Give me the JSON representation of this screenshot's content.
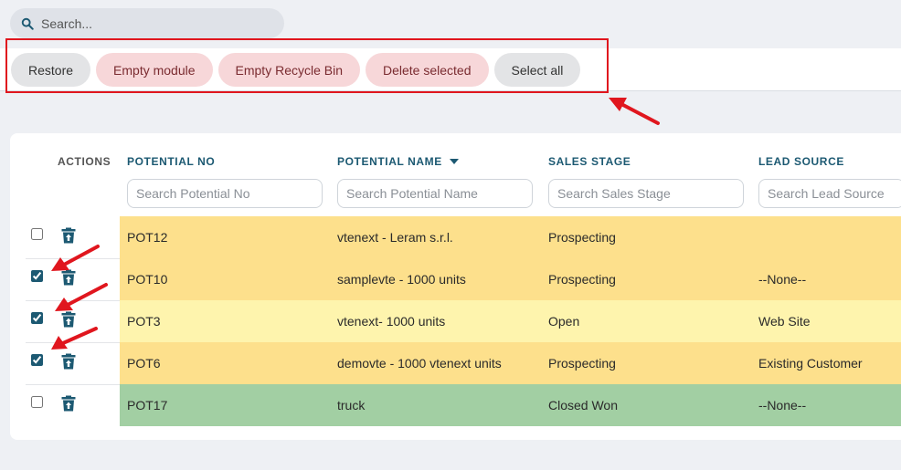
{
  "search": {
    "placeholder": "Search..."
  },
  "toolbar": {
    "restore": "Restore",
    "empty_module": "Empty module",
    "empty_recycle_bin": "Empty Recycle Bin",
    "delete_selected": "Delete selected",
    "select_all": "Select all"
  },
  "table": {
    "headers": {
      "actions": "ACTIONS",
      "potential_no": "POTENTIAL NO",
      "potential_name": "POTENTIAL NAME",
      "sales_stage": "SALES STAGE",
      "lead_source": "LEAD SOURCE"
    },
    "filters": {
      "potential_no": "Search Potential No",
      "potential_name": "Search Potential Name",
      "sales_stage": "Search Sales Stage",
      "lead_source": "Search Lead Source"
    },
    "rows": [
      {
        "no": "POT12",
        "name": "vtenext - Leram s.r.l.",
        "stage": "Prospecting",
        "source": "",
        "checked": false,
        "color": "#fde08c"
      },
      {
        "no": "POT10",
        "name": "samplevte - 1000 units",
        "stage": "Prospecting",
        "source": "--None--",
        "checked": true,
        "color": "#fde08c"
      },
      {
        "no": "POT3",
        "name": "vtenext- 1000 units",
        "stage": "Open",
        "source": "Web Site",
        "checked": true,
        "color": "#fef4ad"
      },
      {
        "no": "POT6",
        "name": "demovte - 1000 vtenext units",
        "stage": "Prospecting",
        "source": "Existing Customer",
        "checked": true,
        "color": "#fde08c"
      },
      {
        "no": "POT17",
        "name": "truck",
        "stage": "Closed Won",
        "source": "--None--",
        "checked": false,
        "color": "#a2cfa3"
      }
    ]
  },
  "colors": {
    "annotation_red": "#e0161e",
    "header_teal": "#1c5972",
    "danger_button_bg": "#f7d7d9",
    "neutral_button_bg": "#e3e4e6"
  },
  "icons": {
    "search": "search-icon",
    "row_action": "restore-trash-icon"
  }
}
